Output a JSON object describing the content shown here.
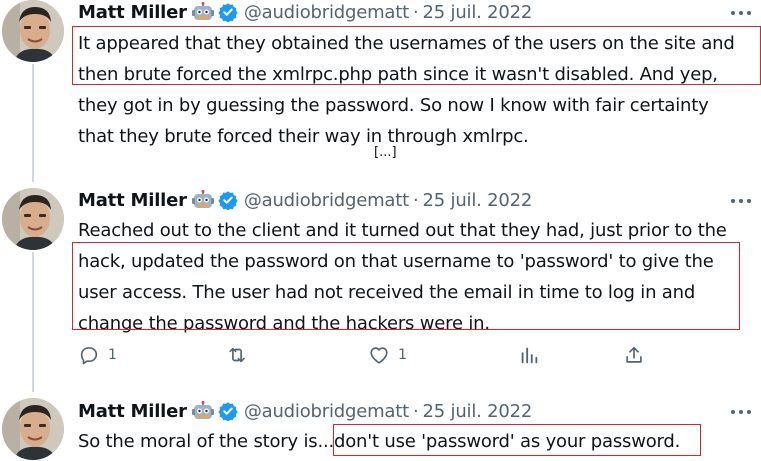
{
  "author": {
    "name": "Matt Miller",
    "emoji": "robot-face",
    "verified_icon": "verified-badge",
    "handle": "@audiobridgematt",
    "separator": "·",
    "date": "25 juil. 2022"
  },
  "tweets": [
    {
      "lines": [
        "It appeared that they obtained the usernames of the users on the site and",
        "then brute forced the xmlrpc.php path since it wasn't disabled. And yep,",
        "they got in by guessing the password. So now I know with fair certainty",
        "that they brute forced their way in through xmlrpc."
      ]
    },
    {
      "lines": [
        "Reached out to the client and it turned out that they had, just prior to the",
        "hack, updated the password on that username to 'password' to give the",
        "user access. The user had not received the email in time to log in and",
        "change the password and the hackers were in."
      ],
      "actions": {
        "reply_count": "1",
        "retweet_count": "",
        "like_count": "1"
      }
    },
    {
      "lines": [
        "So the moral of the story is...don't use 'password' as your password."
      ]
    }
  ],
  "ellipsis": "[...]",
  "colors": {
    "highlight_box": "#d9262c",
    "verified": "#1d9bf0",
    "muted": "#536471"
  }
}
